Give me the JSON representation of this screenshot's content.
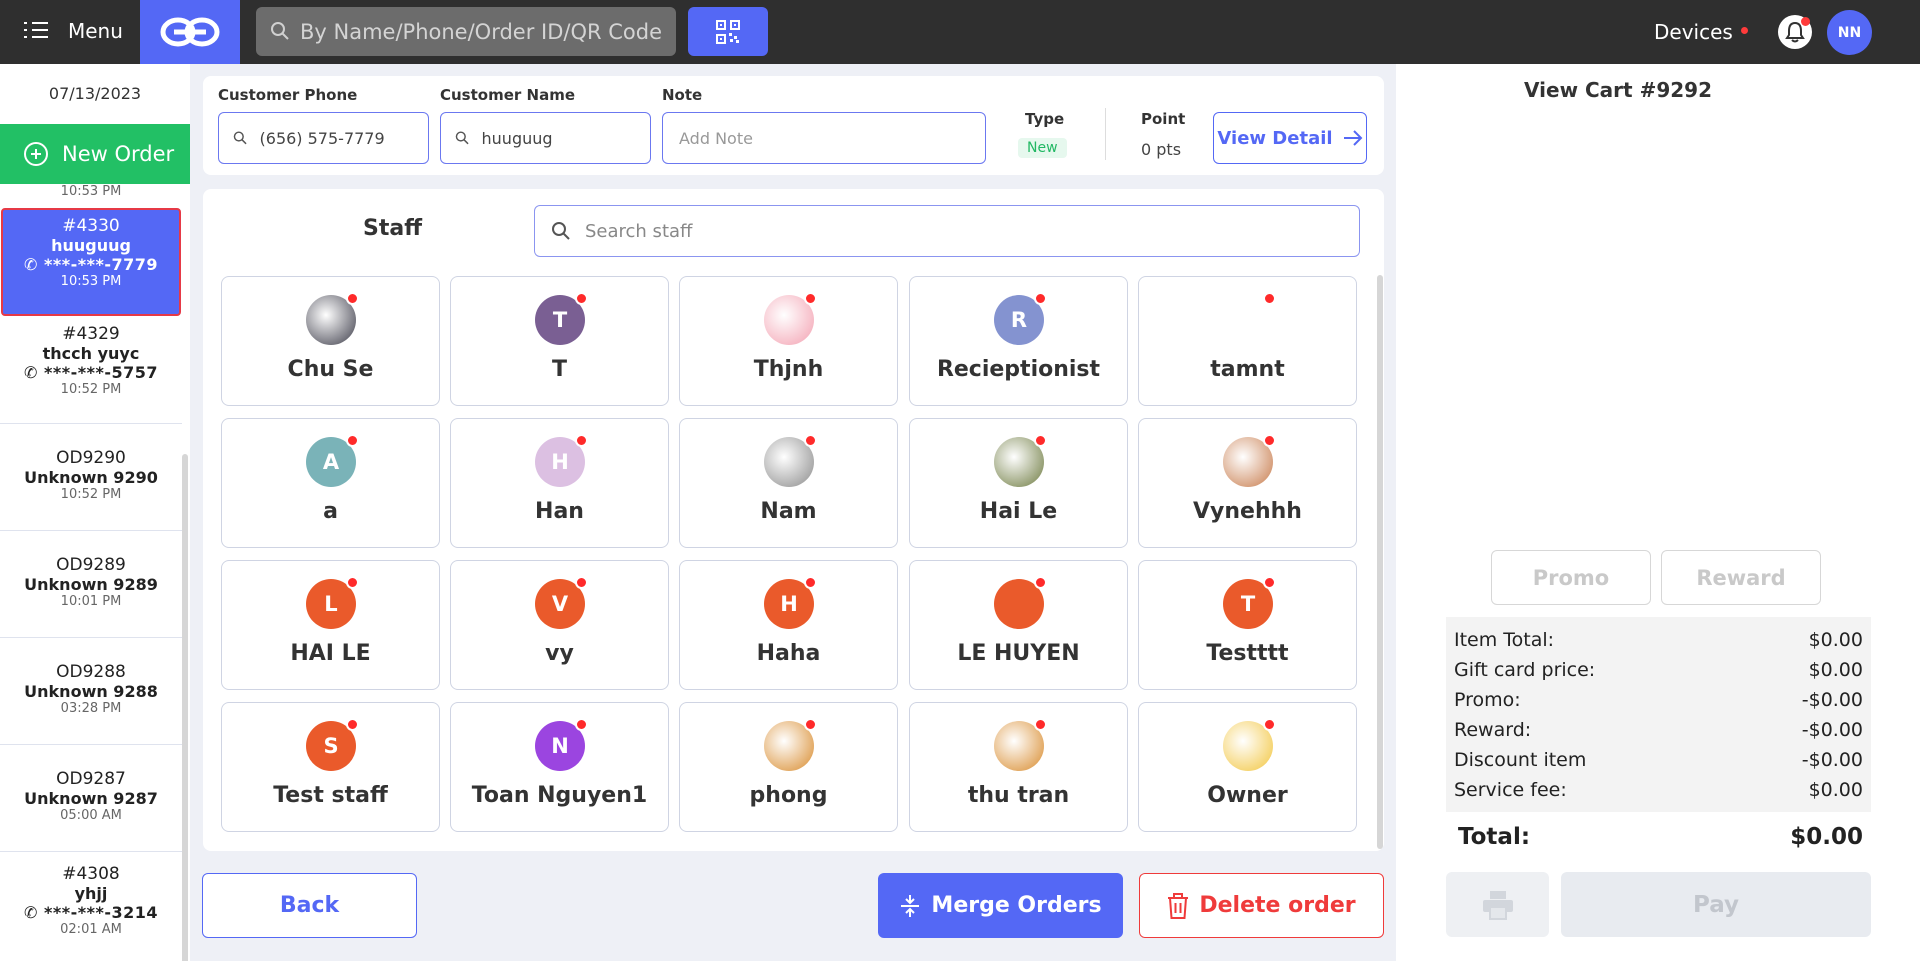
{
  "topbar": {
    "menu_label": "Menu",
    "search_placeholder": "By Name/Phone/Order ID/QR Code",
    "devices_label": "Devices",
    "user_initials": "NN"
  },
  "sidebar": {
    "date": "07/13/2023",
    "new_order_label": "New Order",
    "partial_time": "10:53 PM",
    "orders": [
      {
        "id": "#4330",
        "name": "huuguug",
        "phone": "***-***-7779",
        "time": "10:53 PM",
        "selected": true
      },
      {
        "id": "#4329",
        "name": "thcch yuyc",
        "phone": "***-***-5757",
        "time": "10:52 PM"
      },
      {
        "id": "OD9290",
        "name": "Unknown 9290",
        "time": "10:52 PM"
      },
      {
        "id": "OD9289",
        "name": "Unknown 9289",
        "time": "10:01 PM"
      },
      {
        "id": "OD9288",
        "name": "Unknown 9288",
        "time": "03:28 PM"
      },
      {
        "id": "OD9287",
        "name": "Unknown 9287",
        "time": "05:00 AM"
      },
      {
        "id": "#4308",
        "name": "yhjj",
        "phone": "***-***-3214",
        "time": "02:01 AM"
      }
    ]
  },
  "customer": {
    "phone_label": "Customer Phone",
    "phone_value": "(656) 575-7779",
    "name_label": "Customer Name",
    "name_value": "huuguug",
    "note_label": "Note",
    "note_placeholder": "Add Note",
    "type_label": "Type",
    "type_value": "New",
    "point_label": "Point",
    "point_value": "0 pts",
    "view_detail_label": "View Detail"
  },
  "staff": {
    "title": "Staff",
    "search_placeholder": "Search staff",
    "members": [
      {
        "name": "Chu Se",
        "initial": "",
        "color": "#3b3b48",
        "icon": "gorilla-photo"
      },
      {
        "name": "T",
        "initial": "T",
        "color": "#7a5f93"
      },
      {
        "name": "Thjnh",
        "initial": "",
        "color": "#f3a0b0",
        "icon": "nails-photo"
      },
      {
        "name": "Recieptionist",
        "initial": "R",
        "color": "#8493d0"
      },
      {
        "name": "tamnt",
        "initial": "",
        "color": "#ffffff",
        "icon": "cat-photo"
      },
      {
        "name": "a",
        "initial": "A",
        "color": "#7ab3b8"
      },
      {
        "name": "Han",
        "initial": "H",
        "color": "#dcc0e2"
      },
      {
        "name": "Nam",
        "initial": "",
        "color": "#8a8a8a",
        "icon": "bw-photo"
      },
      {
        "name": "Hai Le",
        "initial": "",
        "color": "#6d7a3f",
        "icon": "nature-photo"
      },
      {
        "name": "Vynehhh",
        "initial": "",
        "color": "#c77a4a",
        "icon": "puppy-photo"
      },
      {
        "name": "HAI LE",
        "initial": "L",
        "color": "#ea5a2b"
      },
      {
        "name": "vy",
        "initial": "V",
        "color": "#ea5a2b"
      },
      {
        "name": "Haha",
        "initial": "H",
        "color": "#ea5a2b"
      },
      {
        "name": "LE HUYEN",
        "initial": "",
        "color": "#ea5a2b"
      },
      {
        "name": "Testttt",
        "initial": "T",
        "color": "#ea5a2b"
      },
      {
        "name": "Test staff",
        "initial": "S",
        "color": "#ea5a2b"
      },
      {
        "name": "Toan Nguyen1",
        "initial": "N",
        "color": "#9b45e0"
      },
      {
        "name": "phong",
        "initial": "",
        "color": "#d88a2b",
        "icon": "tiger-photo"
      },
      {
        "name": "thu tran",
        "initial": "",
        "color": "#d88a2b",
        "icon": "tiger-photo"
      },
      {
        "name": "Owner",
        "initial": "",
        "color": "#f2c53d",
        "icon": "pikachu-photo"
      }
    ]
  },
  "actions": {
    "back_label": "Back",
    "merge_label": "Merge Orders",
    "delete_label": "Delete order"
  },
  "cart": {
    "title": "View Cart #9292",
    "promo_label": "Promo",
    "reward_label": "Reward",
    "rows": [
      {
        "label": "Item Total:",
        "value": "$0.00"
      },
      {
        "label": "Gift card price:",
        "value": "$0.00"
      },
      {
        "label": "Promo:",
        "value": "-$0.00"
      },
      {
        "label": "Reward:",
        "value": "-$0.00"
      },
      {
        "label": "Discount item",
        "value": "-$0.00"
      },
      {
        "label": "Service fee:",
        "value": "$0.00"
      }
    ],
    "total_label": "Total:",
    "total_value": "$0.00",
    "pay_label": "Pay"
  }
}
